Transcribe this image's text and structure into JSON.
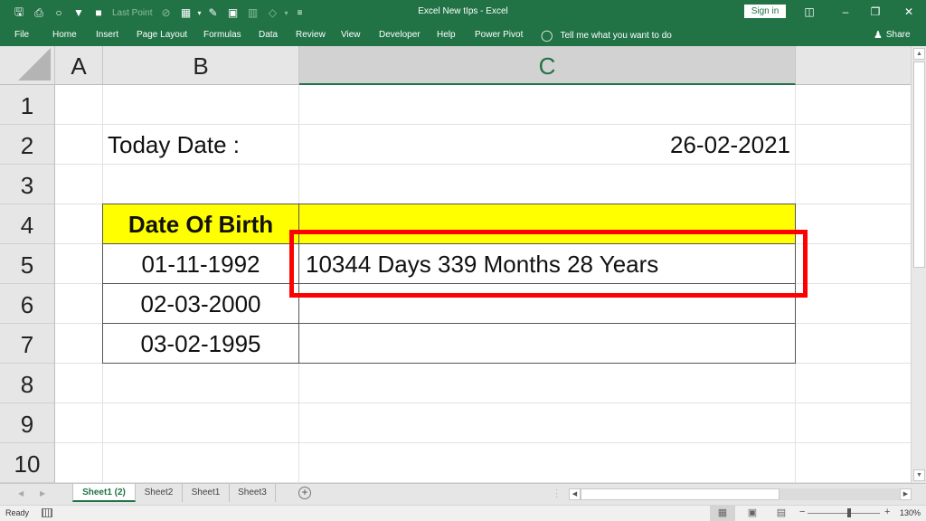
{
  "window": {
    "title": "Excel New tIps  -  Excel",
    "sign_in": "Sign in",
    "ribbon_display_icon": "ribbon-display-options-icon",
    "minimize_icon": "minimize-icon",
    "restore_icon": "restore-icon",
    "close_icon": "close-icon"
  },
  "quick_access": {
    "items": [
      {
        "icon": "save-icon",
        "glyph": "🖫"
      },
      {
        "icon": "attach-icon",
        "glyph": "📎"
      },
      {
        "icon": "circle-shape-icon",
        "glyph": "○"
      },
      {
        "icon": "filter-icon",
        "glyph": "▼"
      },
      {
        "icon": "square-icon",
        "glyph": "■"
      },
      {
        "icon": "last-point-label",
        "label": "Last Point"
      },
      {
        "icon": "no-edit-icon",
        "glyph": "⊘"
      },
      {
        "icon": "table-icon",
        "glyph": "▦"
      },
      {
        "icon": "dropdown-arrow-icon",
        "glyph": "▾"
      },
      {
        "icon": "edit-form-icon",
        "glyph": "✎"
      },
      {
        "icon": "window-icon",
        "glyph": "▣"
      },
      {
        "icon": "clipboard-icon",
        "glyph": "▥"
      },
      {
        "icon": "shapes-icon",
        "glyph": "◇"
      },
      {
        "icon": "dropdown-arrow-icon",
        "glyph": "▾"
      },
      {
        "icon": "customize-qat-icon",
        "glyph": "≡"
      }
    ]
  },
  "ribbon": {
    "tabs": [
      "File",
      "Home",
      "Insert",
      "Page Layout",
      "Formulas",
      "Data",
      "Review",
      "View",
      "Developer",
      "Help",
      "Power Pivot"
    ],
    "tell_me": "Tell me what you want to do",
    "share": "Share"
  },
  "grid": {
    "columns": [
      "A",
      "B",
      "C"
    ],
    "selected_column": "C",
    "rows": [
      "1",
      "2",
      "3",
      "4",
      "5",
      "6",
      "7",
      "8",
      "9",
      "10"
    ],
    "cells": {
      "B2": "Today Date :",
      "C2": "26-02-2021",
      "B4": "Date Of Birth",
      "C4": "",
      "B5": "01-11-1992",
      "C5": "10344 Days 339 Months 28 Years",
      "B6": "02-03-2000",
      "C6": "",
      "B7": "03-02-1995",
      "C7": ""
    },
    "header_fill": "#ffff00",
    "highlight_color": "#ff0000"
  },
  "sheets": {
    "tabs": [
      "Sheet1 (2)",
      "Sheet2",
      "Sheet1",
      "Sheet3"
    ],
    "active": "Sheet1 (2)",
    "add_label": "+"
  },
  "status": {
    "ready": "Ready",
    "zoom": "130%",
    "zoom_minus": "−",
    "zoom_plus": "+"
  },
  "colors": {
    "excel_green": "#217346"
  }
}
